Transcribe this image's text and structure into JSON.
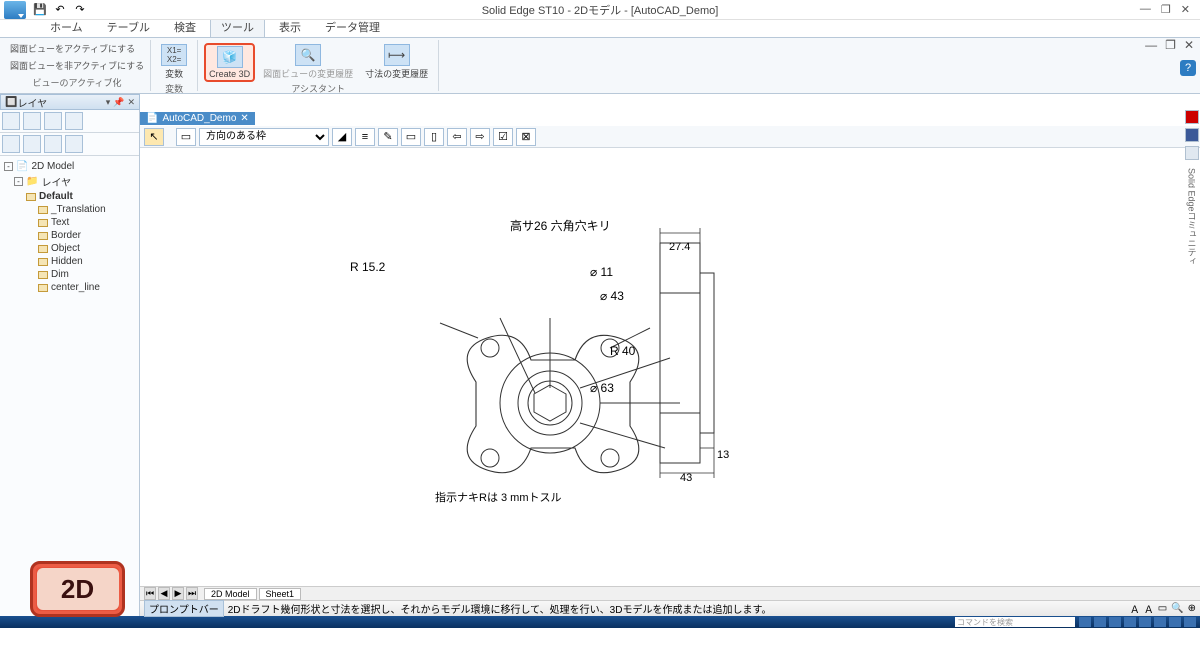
{
  "app": {
    "title": "Solid Edge ST10 - 2Dモデル - [AutoCAD_Demo]"
  },
  "tabs": {
    "home": "ホーム",
    "table": "テーブル",
    "inspect": "検査",
    "tools": "ツール",
    "view": "表示",
    "data": "データ管理"
  },
  "ribbon": {
    "activate": {
      "line1": "図面ビューをアクティブにする",
      "line2": "図面ビューを非アクティブにする",
      "group": "ビューのアクティブ化"
    },
    "var_group": "変数",
    "var_label": "変数",
    "create3d": "Create 3D",
    "history": "図面ビューの変更履歴",
    "dim_history": "寸法の変更履歴",
    "assist_group": "アシスタント"
  },
  "left_panel": {
    "title": "レイヤ",
    "root": "2D Model",
    "layers_node": "レイヤ",
    "layers": {
      "default": "Default",
      "translation": "_Translation",
      "text": "Text",
      "border": "Border",
      "object": "Object",
      "hidden": "Hidden",
      "dim": "Dim",
      "center": "center_line"
    }
  },
  "doc_tab": "AutoCAD_Demo",
  "canvas_dropdown": "方向のある枠",
  "drawing": {
    "annot_top": "高サ26  六角穴キリ",
    "r152": "R 15.2",
    "d11": "⌀ 11",
    "d43": "⌀ 43",
    "r40": "R 40",
    "d63": "⌀ 63",
    "dim274": "27.4",
    "dim13": "13",
    "dim43": "43",
    "note": "指示ナキRは 3 mmトスル"
  },
  "badge": "2D",
  "sheets": {
    "s1": "2D Model",
    "s2": "Sheet1"
  },
  "status": {
    "label": "プロンプトバー",
    "msg": "2Dドラフト幾何形状と寸法を選択し、それからモデル環境に移行して、処理を行い、3Dモデルを作成または追加します。"
  },
  "task_search_placeholder": "コマンドを検索",
  "right_strip_text": "Solid Edgeコミュニティ"
}
